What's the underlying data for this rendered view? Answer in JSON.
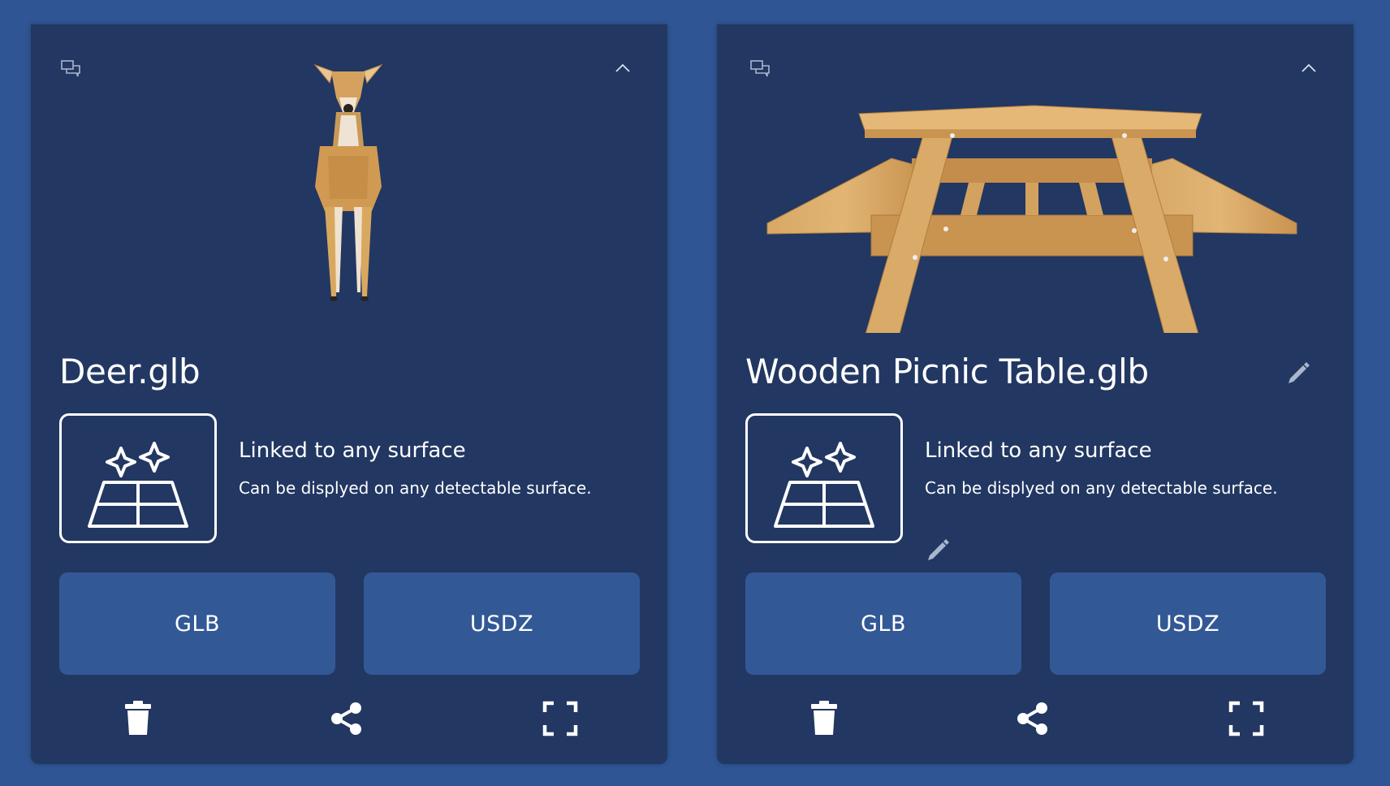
{
  "cards": [
    {
      "id": "deer",
      "title": "Deer.glb",
      "surface": {
        "title": "Linked to any surface",
        "description": "Can be displyed on any detectable surface."
      },
      "buttons": {
        "glb": "GLB",
        "usdz": "USDZ"
      },
      "model_icon": "deer-model",
      "editable_title": false,
      "editable_surface": false
    },
    {
      "id": "picnic-table",
      "title": "Wooden Picnic Table.glb",
      "surface": {
        "title": "Linked to any surface",
        "description": "Can be displyed on any detectable surface."
      },
      "buttons": {
        "glb": "GLB",
        "usdz": "USDZ"
      },
      "model_icon": "picnic-table-model",
      "editable_title": true,
      "editable_surface": true
    }
  ],
  "colors": {
    "page_background": "#2f5594",
    "card_background": "#223762",
    "button_background": "#335896",
    "text": "#ffffff",
    "muted_icon": "#a9b6cc"
  },
  "icons": {
    "top_left": "comments-icon",
    "top_right": "chevron-up-icon",
    "surface": "sparkle-surface-icon",
    "edit": "pencil-icon",
    "delete": "trash-icon",
    "share": "share-icon",
    "fullscreen": "fullscreen-icon"
  }
}
